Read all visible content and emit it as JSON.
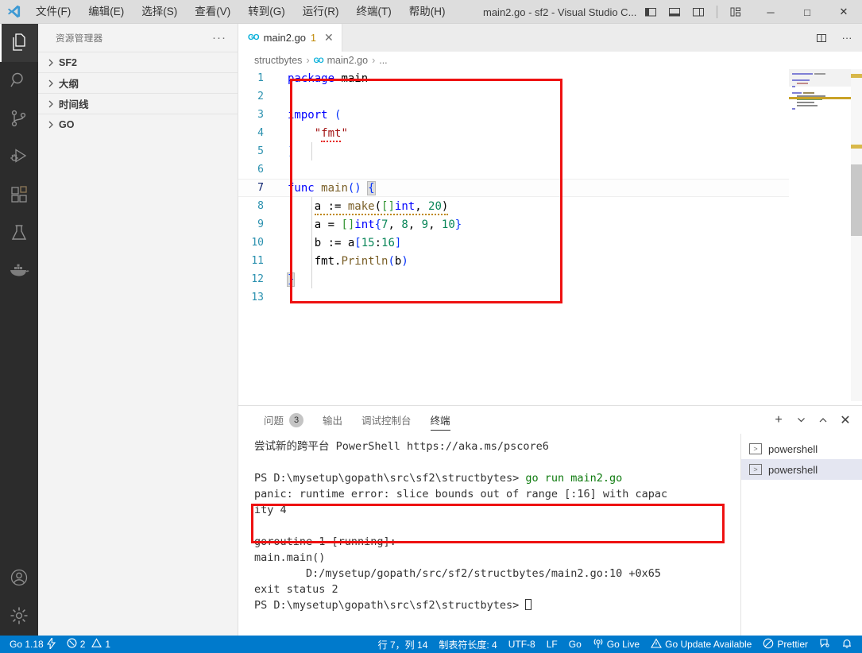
{
  "titlebar": {
    "logo_icon": "vscode-logo-icon",
    "menus": [
      {
        "label": "文件(F)"
      },
      {
        "label": "编辑(E)"
      },
      {
        "label": "选择(S)"
      },
      {
        "label": "查看(V)"
      },
      {
        "label": "转到(G)"
      },
      {
        "label": "运行(R)"
      },
      {
        "label": "终端(T)"
      },
      {
        "label": "帮助(H)"
      }
    ],
    "title": "main2.go - sf2 - Visual Studio C...",
    "layout_buttons": [
      {
        "name": "toggle-primary-sidebar-icon"
      },
      {
        "name": "toggle-panel-icon"
      },
      {
        "name": "toggle-secondary-sidebar-icon"
      },
      {
        "name": "customize-layout-icon"
      }
    ],
    "window_buttons": [
      {
        "name": "minimize-button",
        "glyph": "─"
      },
      {
        "name": "maximize-button",
        "glyph": "□"
      },
      {
        "name": "close-button",
        "glyph": "✕"
      }
    ]
  },
  "activitybar": {
    "items": [
      {
        "name": "explorer",
        "icon": "files-icon",
        "active": true
      },
      {
        "name": "search",
        "icon": "search-icon",
        "active": false
      },
      {
        "name": "source-control",
        "icon": "source-control-icon",
        "active": false
      },
      {
        "name": "run-and-debug",
        "icon": "debug-icon",
        "active": false
      },
      {
        "name": "extensions",
        "icon": "extensions-icon",
        "active": false
      },
      {
        "name": "testing",
        "icon": "beaker-icon",
        "active": false
      },
      {
        "name": "docker",
        "icon": "docker-whale-icon",
        "active": false
      }
    ],
    "bottom_items": [
      {
        "name": "accounts",
        "icon": "account-icon"
      },
      {
        "name": "settings",
        "icon": "gear-icon"
      }
    ]
  },
  "sidebar": {
    "header_title": "资源管理器",
    "more_actions": "···",
    "sections": [
      {
        "label": "SF2",
        "expanded": false
      },
      {
        "label": "大纲",
        "expanded": false
      },
      {
        "label": "时间线",
        "expanded": false
      },
      {
        "label": "GO",
        "expanded": false
      }
    ]
  },
  "editor": {
    "tabs": [
      {
        "icon": "go-file-icon",
        "label": "main2.go",
        "badge": "1",
        "close": "✕",
        "active": true
      }
    ],
    "tab_actions": [
      {
        "name": "split-editor-right-icon"
      },
      {
        "name": "more-editor-actions-icon",
        "glyph": "···"
      }
    ],
    "breadcrumb": [
      "structbytes",
      "main2.go",
      "..."
    ],
    "cursor_line": 7,
    "lines": [
      {
        "n": "1",
        "text": "package main"
      },
      {
        "n": "2",
        "text": ""
      },
      {
        "n": "3",
        "text": "import ("
      },
      {
        "n": "4",
        "text": "    \"fmt\""
      },
      {
        "n": "5",
        "text": ")"
      },
      {
        "n": "6",
        "text": ""
      },
      {
        "n": "7",
        "text": "func main() {"
      },
      {
        "n": "8",
        "text": "    a := make([]int, 20)"
      },
      {
        "n": "9",
        "text": "    a = []int{7, 8, 9, 10}"
      },
      {
        "n": "10",
        "text": "    b := a[15:16]"
      },
      {
        "n": "11",
        "text": "    fmt.Println(b)"
      },
      {
        "n": "12",
        "text": "}"
      },
      {
        "n": "13",
        "text": ""
      }
    ]
  },
  "panel": {
    "tabs": [
      {
        "label": "问题",
        "count": "3",
        "active": false
      },
      {
        "label": "输出",
        "count": null,
        "active": false
      },
      {
        "label": "调试控制台",
        "count": null,
        "active": false
      },
      {
        "label": "终端",
        "count": null,
        "active": true
      }
    ],
    "actions": [
      {
        "name": "new-terminal-button",
        "glyph": "+"
      },
      {
        "name": "terminal-dropdown-button",
        "glyph": "⌄"
      },
      {
        "name": "maximize-panel-button",
        "glyph": "⌃"
      },
      {
        "name": "close-panel-button",
        "glyph": "✕"
      }
    ],
    "terminal_lines": [
      "尝试新的跨平台 PowerShell https://aka.ms/pscore6",
      "",
      "PS D:\\mysetup\\gopath\\src\\sf2\\structbytes> go run main2.go",
      "panic: runtime error: slice bounds out of range [:16] with capac",
      "ity 4",
      "",
      "goroutine 1 [running]:",
      "main.main()",
      "        D:/mysetup/gopath/src/sf2/structbytes/main2.go:10 +0x65",
      "exit status 2",
      "PS D:\\mysetup\\gopath\\src\\sf2\\structbytes> "
    ],
    "prompt_command": "go run main2.go",
    "terminal_list": [
      {
        "icon": "terminal-powershell-icon",
        "label": "powershell",
        "selected": false
      },
      {
        "icon": "terminal-powershell-icon",
        "label": "powershell",
        "selected": true
      }
    ]
  },
  "statusbar": {
    "left": [
      {
        "name": "go-version",
        "label": "Go 1.18",
        "icon": "lightning-icon"
      },
      {
        "name": "problems",
        "error_icon": "error-circle-icon",
        "errors": "2",
        "warning_icon": "warning-triangle-icon",
        "warnings": "1"
      }
    ],
    "right": [
      {
        "name": "cursor-position",
        "label": "行 7，列 14"
      },
      {
        "name": "indentation",
        "label": "制表符长度: 4"
      },
      {
        "name": "encoding",
        "label": "UTF-8"
      },
      {
        "name": "eol",
        "label": "LF"
      },
      {
        "name": "language-mode",
        "label": "Go"
      },
      {
        "name": "go-live",
        "label": "Go Live",
        "icon": "broadcast-icon"
      },
      {
        "name": "go-update",
        "label": "Go Update Available",
        "icon": "warning-triangle-icon"
      },
      {
        "name": "prettier",
        "label": "Prettier",
        "icon": "circle-slash-icon"
      },
      {
        "name": "feedback",
        "label": "",
        "icon": "feedback-icon"
      },
      {
        "name": "notifications",
        "label": "",
        "icon": "bell-icon"
      }
    ]
  },
  "annotations": {
    "accent_color": "#ee1111",
    "code_box": "highlights the Go source with the out-of-range slice",
    "terminal_box": "highlights the panic message"
  },
  "colors": {
    "titlebar_bg": "#dddddd",
    "activitybar_bg": "#2c2c2c",
    "sidebar_bg": "#f3f3f3",
    "editor_bg": "#ffffff",
    "statusbar_bg": "#007acc",
    "keyword": "#0000ff",
    "string": "#a31515",
    "number": "#098658",
    "annotation": "#ee1111"
  }
}
